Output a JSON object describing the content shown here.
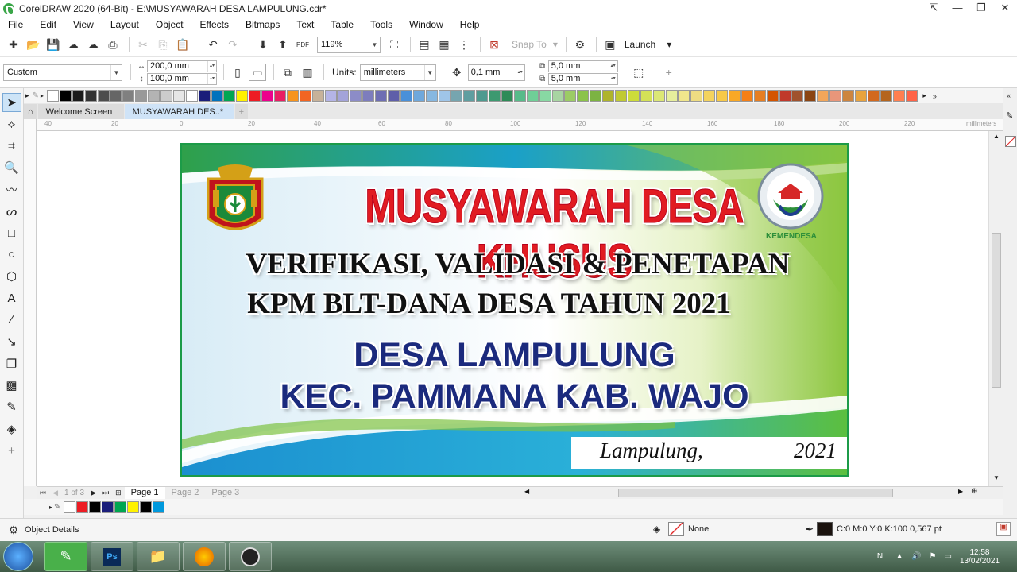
{
  "window": {
    "title": "CorelDRAW 2020 (64-Bit) - E:\\MUSYAWARAH DESA LAMPULUNG.cdr*",
    "controls": [
      "⇱",
      "—",
      "❐",
      "✕"
    ]
  },
  "menu": [
    "File",
    "Edit",
    "View",
    "Layout",
    "Object",
    "Effects",
    "Bitmaps",
    "Text",
    "Table",
    "Tools",
    "Window",
    "Help"
  ],
  "toolbar": {
    "zoom": "119%",
    "snap_to": "Snap To",
    "launch": "Launch",
    "pdf_label": "PDF"
  },
  "propbar": {
    "page_preset": "Custom",
    "width": "200,0 mm",
    "height": "100,0 mm",
    "units_label": "Units:",
    "units_value": "millimeters",
    "nudge": "0,1 mm",
    "dup_x": "5,0 mm",
    "dup_y": "5,0 mm"
  },
  "tabs": [
    {
      "label": "Welcome Screen",
      "active": false
    },
    {
      "label": "MUSYAWARAH DES..*",
      "active": true
    }
  ],
  "ruler": {
    "labels": [
      "40",
      "20",
      "0",
      "20",
      "40",
      "60",
      "80",
      "100",
      "120",
      "140",
      "160",
      "180",
      "200",
      "220"
    ],
    "units": "millimeters"
  },
  "banner": {
    "title": "MUSYAWARAH DESA KHUSUS",
    "subtitle_1": "VERIFIKASI, VALIDASI & PENETAPAN",
    "subtitle_2": "KPM BLT-DANA DESA TAHUN 2021",
    "village": "DESA LAMPULUNG",
    "district": "KEC. PAMMANA KAB. WAJO",
    "place": "Lampulung,",
    "year": "2021",
    "logo_right_label": "KEMENDESA",
    "colors": {
      "title": "#e11b22",
      "blue_text": "#1b2a7d",
      "border": "#1c9b48"
    }
  },
  "pages": {
    "counter": "1 of 3",
    "tabs": [
      "Page 1",
      "Page 2",
      "Page 3"
    ],
    "active": "Page 1"
  },
  "status": {
    "object_details": "Object Details",
    "fill": "None",
    "outline": "C:0 M:0 Y:0 K:100  0,567 pt"
  },
  "taskbar": {
    "lang": "IN",
    "time": "12:58",
    "date": "13/02/2021"
  },
  "palette_top": [
    "#ffffff",
    "#000000",
    "#1a1a1a",
    "#333333",
    "#4d4d4d",
    "#666666",
    "#808080",
    "#999999",
    "#b3b3b3",
    "#cccccc",
    "#e6e6e6",
    "#ffffff",
    "#1b1e7a",
    "#0072bc",
    "#00a651",
    "#fff200",
    "#ed1c24",
    "#ec008c",
    "#e91e63",
    "#f7941d",
    "#f26522",
    "#c7b299",
    "#b4b4e6",
    "#a3a3d9",
    "#8c8cc7",
    "#7d7dbd",
    "#6e6eb3",
    "#5f5fa9",
    "#4a90d9",
    "#6fa8dc",
    "#86b7e0",
    "#9fc5e8",
    "#76a5af",
    "#5f9ea0",
    "#4e9a8f",
    "#3d9970",
    "#2e8b57",
    "#57bb8a",
    "#6fcf97",
    "#88d8a3",
    "#a8d5a2",
    "#9ccc65",
    "#8bc34a",
    "#7cb342",
    "#afb42b",
    "#c0ca33",
    "#cddc39",
    "#d4e157",
    "#dce775",
    "#e6ee9c",
    "#f0e68c",
    "#eedc82",
    "#f4d35e",
    "#f7c948",
    "#f9a825",
    "#f57f17",
    "#e67e22",
    "#d35400",
    "#c0392b",
    "#a0522d",
    "#8b4513",
    "#f2a65a",
    "#e9967a",
    "#cd853f",
    "#e8a33d",
    "#d2691e",
    "#b5651d",
    "#ff7f50",
    "#ff6347"
  ],
  "palette_bottom": [
    "#ffffff",
    "#ed1c24",
    "#000000",
    "#1b1e7a",
    "#00a651",
    "#fff200",
    "#000000",
    "#0099dd"
  ]
}
